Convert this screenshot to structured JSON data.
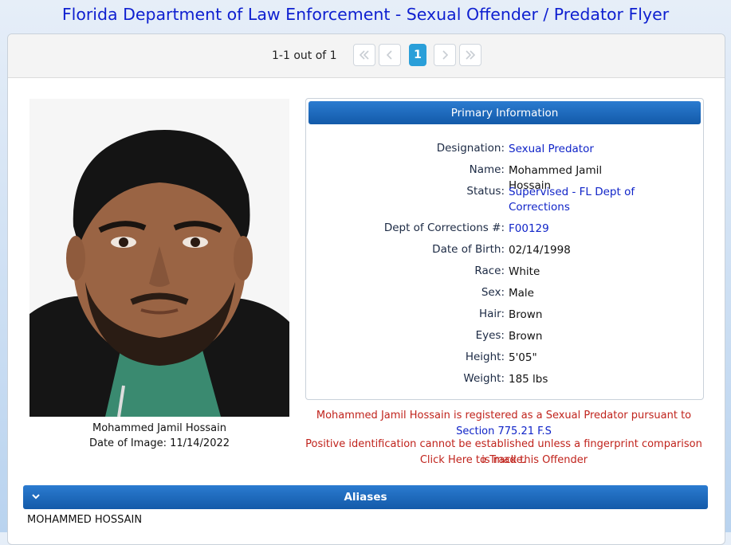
{
  "header": {
    "title": "Florida Department of Law Enforcement - Sexual Offender / Predator Flyer"
  },
  "pager": {
    "count_text": "1-1 out of 1",
    "current_page": "1",
    "buttons": [
      "first-page-icon",
      "previous-page-icon",
      "next-page-icon",
      "last-page-icon"
    ]
  },
  "photo": {
    "caption_name": "Mohammed Jamil Hossain",
    "caption_date": "Date of Image: 11/14/2022"
  },
  "primary_info": {
    "title": "Primary Information",
    "designation_label": "Designation:",
    "designation": "Sexual Predator",
    "name_label": "Name:",
    "name": "Mohammed Jamil Hossain",
    "status_label": "Status:",
    "status": "Supervised - FL Dept of Corrections",
    "doc_label": "Dept of Corrections #:",
    "doc_number": "F00129",
    "dob_label": "Date of Birth:",
    "dob": "02/14/1998",
    "race_label": "Race:",
    "race": "White",
    "sex_label": "Sex:",
    "sex": "Male",
    "hair_label": "Hair:",
    "hair": "Brown",
    "eyes_label": "Eyes:",
    "eyes": "Brown",
    "height_label": "Height:",
    "height": "5'05\"",
    "weight_label": "Weight:",
    "weight": "185 lbs"
  },
  "notice": {
    "registered_text": "Mohammed Jamil Hossain is registered as a Sexual Predator pursuant to",
    "section_link": "Section 775.21 F.S",
    "fingerprint_text": "Positive identification cannot be established unless a fingerprint comparison is made.",
    "track_link": "Click Here to Track this Offender"
  },
  "aliases": {
    "title": "Aliases",
    "items": [
      "MOHAMMED HOSSAIN"
    ]
  },
  "colors": {
    "title_blue": "#0e1fd0",
    "header_blue": "#135aa9",
    "link_blue": "#1024c8",
    "notice_red": "#c0231c",
    "active_page": "#2a9fd9"
  }
}
